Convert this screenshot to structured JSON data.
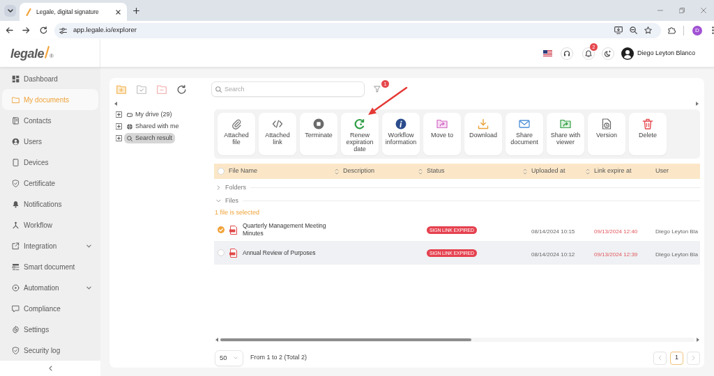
{
  "browser": {
    "tab": {
      "title": "Legale, digital signature"
    },
    "url": "app.legale.io/explorer",
    "profile_initial": "D"
  },
  "header": {
    "logo": {
      "text": "legale",
      "registered": "®"
    },
    "notification_count": "2",
    "user_name": "Diego Leyton Blanco"
  },
  "sidebar": {
    "items": [
      {
        "label": "Dashboard",
        "selected": false,
        "expandable": false
      },
      {
        "label": "My documents",
        "selected": true,
        "expandable": false
      },
      {
        "label": "Contacts",
        "selected": false,
        "expandable": false
      },
      {
        "label": "Users",
        "selected": false,
        "expandable": false
      },
      {
        "label": "Devices",
        "selected": false,
        "expandable": false
      },
      {
        "label": "Certificate",
        "selected": false,
        "expandable": false
      },
      {
        "label": "Notifications",
        "selected": false,
        "expandable": false
      },
      {
        "label": "Workflow",
        "selected": false,
        "expandable": false
      },
      {
        "label": "Integration",
        "selected": false,
        "expandable": true
      },
      {
        "label": "Smart document",
        "selected": false,
        "expandable": false
      },
      {
        "label": "Automation",
        "selected": false,
        "expandable": true
      },
      {
        "label": "Compliance",
        "selected": false,
        "expandable": false
      },
      {
        "label": "Settings",
        "selected": false,
        "expandable": false
      },
      {
        "label": "Security log",
        "selected": false,
        "expandable": false
      }
    ]
  },
  "explorer": {
    "search": {
      "placeholder": "Search"
    },
    "filter_count": "1",
    "tree": [
      {
        "label": "My drive (29)",
        "expanded": false,
        "selected": false
      },
      {
        "label": "Shared with me",
        "expanded": false,
        "selected": false
      },
      {
        "label": "Search result",
        "expanded": false,
        "selected": true
      }
    ],
    "actions": [
      {
        "label": "Attached file"
      },
      {
        "label": "Attached link"
      },
      {
        "label": "Terminate"
      },
      {
        "label": "Renew expiration date"
      },
      {
        "label": "Workflow information"
      },
      {
        "label": "Move to"
      },
      {
        "label": "Download"
      },
      {
        "label": "Share document"
      },
      {
        "label": "Share with viewer"
      },
      {
        "label": "Version"
      },
      {
        "label": "Delete"
      }
    ],
    "table": {
      "all_selected": false,
      "columns": [
        {
          "label": "File Name",
          "sortable": false
        },
        {
          "label": "Description",
          "sortable": true
        },
        {
          "label": "Status",
          "sortable": true
        },
        {
          "label": "Uploaded at",
          "sortable": true
        },
        {
          "label": "Link expire at",
          "sortable": true
        },
        {
          "label": "User",
          "sortable": false
        }
      ],
      "groups": [
        {
          "label": "Folders",
          "expanded": false
        },
        {
          "label": "Files",
          "expanded": true,
          "selection_note": "1 file is selected",
          "rows": [
            {
              "selected": true,
              "highlighted": false,
              "file_name": "Quarterly Management Meeting Minutes",
              "status": "SIGN LINK EXPIRED",
              "uploaded_at": "08/14/2024 10:15",
              "link_expire_at": "09/13/2024 12:40",
              "user": "Diego Leyton Bla"
            },
            {
              "selected": false,
              "highlighted": true,
              "file_name": "Annual Review of Purposes",
              "status": "SIGN LINK EXPIRED",
              "uploaded_at": "08/14/2024 10:12",
              "link_expire_at": "09/13/2024 12:39",
              "user": "Diego Leyton Bla"
            }
          ]
        }
      ]
    },
    "pagination": {
      "page_size": "50",
      "summary": "From 1 to 2 (Total 2)",
      "previous_disabled": true,
      "next_disabled": true,
      "pages": [
        {
          "label": "1",
          "selected": true
        }
      ]
    }
  }
}
